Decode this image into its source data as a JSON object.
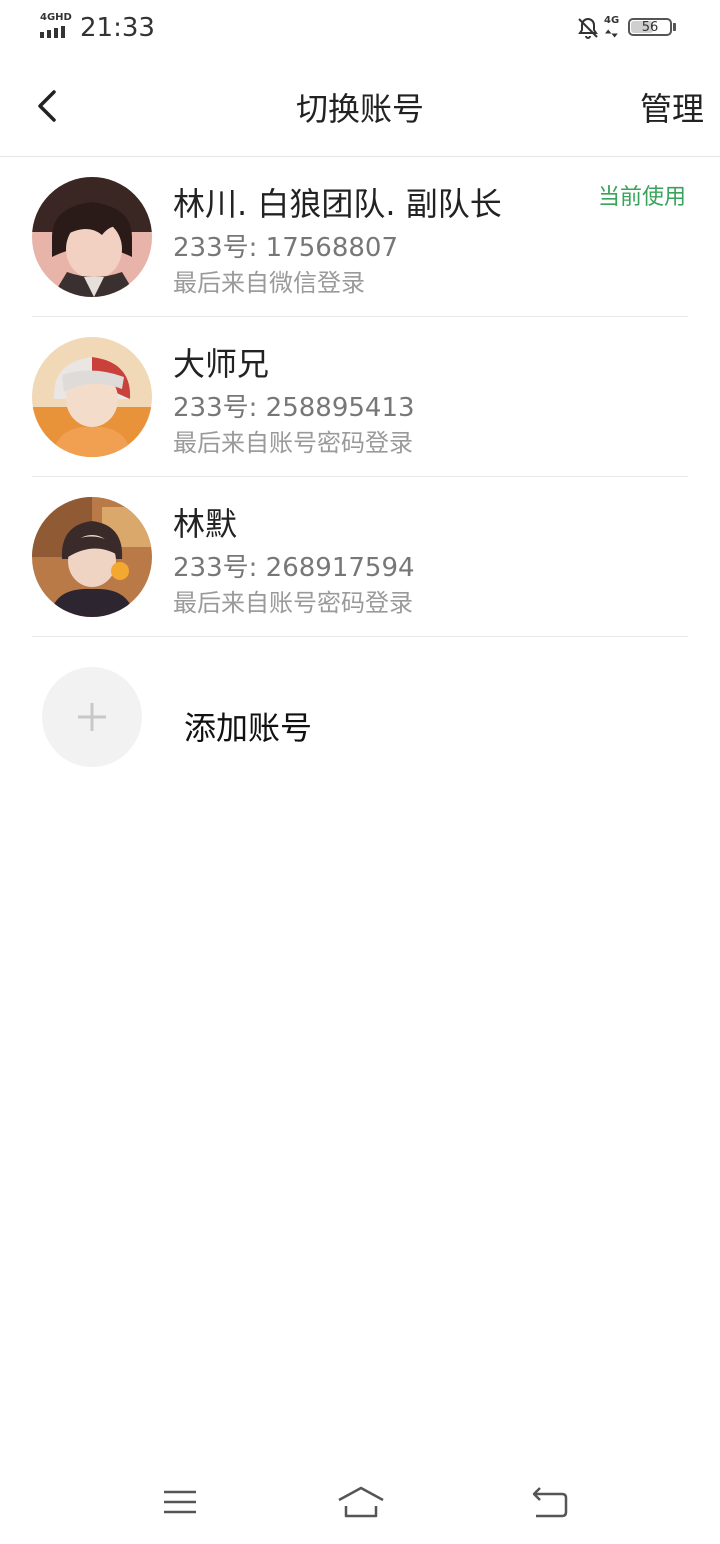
{
  "status_bar": {
    "network": "4GHD",
    "time": "21:33",
    "network_right": "4G",
    "battery": "56"
  },
  "nav": {
    "title": "切换账号",
    "manage": "管理"
  },
  "accounts": [
    {
      "name": "林川. 白狼团队. 副队长",
      "uid": "233号: 17568807",
      "login": "最后来自微信登录",
      "badge": "当前使用"
    },
    {
      "name": "大师兄",
      "uid": "233号: 258895413",
      "login": "最后来自账号密码登录"
    },
    {
      "name": "林默",
      "uid": "233号: 268917594",
      "login": "最后来自账号密码登录"
    }
  ],
  "add_account": {
    "label": "添加账号"
  },
  "colors": {
    "current_badge": "#3aa35b",
    "divider": "#e8e8e8"
  }
}
